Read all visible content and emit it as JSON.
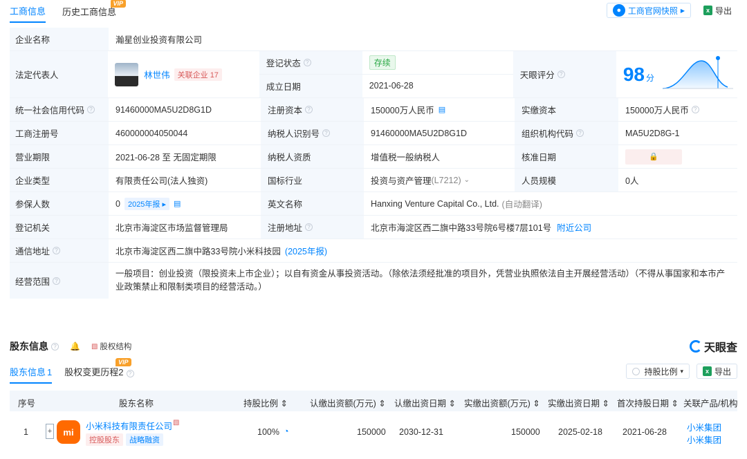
{
  "top_tabs": {
    "business": "工商信息",
    "history": "历史工商信息",
    "vip": "VIP"
  },
  "top_actions": {
    "snapshot": "工商官网快照",
    "export": "导出"
  },
  "info": {
    "company_name_label": "企业名称",
    "company_name": "瀚星创业投资有限公司",
    "legal_rep_label": "法定代表人",
    "legal_rep": "林世伟",
    "related_label": "关联企业",
    "related_count": "17",
    "reg_status_label": "登记状态",
    "reg_status": "存续",
    "est_date_label": "成立日期",
    "est_date": "2021-06-28",
    "tianyan_label": "天眼评分",
    "score": "98",
    "score_unit": "分",
    "credit_code_label": "统一社会信用代码",
    "credit_code": "91460000MA5U2D8G1D",
    "reg_capital_label": "注册资本",
    "reg_capital": "150000万人民币",
    "paid_capital_label": "实缴资本",
    "paid_capital": "150000万人民币",
    "reg_no_label": "工商注册号",
    "reg_no": "460000004050044",
    "taxpayer_id_label": "纳税人识别号",
    "taxpayer_id": "91460000MA5U2D8G1D",
    "org_code_label": "组织机构代码",
    "org_code": "MA5U2D8G-1",
    "term_label": "营业期限",
    "term": "2021-06-28 至 无固定期限",
    "taxpayer_qual_label": "纳税人资质",
    "taxpayer_qual": "增值税一般纳税人",
    "approval_label": "核准日期",
    "type_label": "企业类型",
    "type": "有限责任公司(法人独资)",
    "industry_label": "国标行业",
    "industry": "投资与资产管理",
    "industry_code": "(L7212)",
    "staff_label": "人员规模",
    "staff": "0人",
    "insured_label": "参保人数",
    "insured": "0",
    "insured_report": "2025年报",
    "english_label": "英文名称",
    "english": "Hanxing Venture Capital Co., Ltd.",
    "auto_translate": "(自动翻译)",
    "authority_label": "登记机关",
    "authority": "北京市海淀区市场监督管理局",
    "address_label": "注册地址",
    "address": "北京市海淀区西二旗中路33号院6号楼7层101号",
    "nearby": "附近公司",
    "mail_label": "通信地址",
    "mail": "北京市海淀区西二旗中路33号院小米科技园",
    "mail_report": "(2025年报)",
    "scope_label": "经营范围",
    "scope": "一般项目：创业投资（限投资未上市企业）；以自有资金从事投资活动。（除依法须经批准的项目外，凭营业执照依法自主开展经营活动）（不得从事国家和本市产业政策禁止和限制类项目的经营活动。）"
  },
  "shareholders": {
    "title": "股东信息",
    "structure": "股权结构",
    "brand": "天眼查",
    "tab_info": "股东信息",
    "tab_info_count": "1",
    "tab_change": "股权变更历程",
    "tab_change_count": "2",
    "vip": "VIP",
    "ratio_btn": "持股比例",
    "export": "导出",
    "columns": [
      "序号",
      "股东名称",
      "持股比例",
      "认缴出资额(万元)",
      "认缴出资日期",
      "实缴出资额(万元)",
      "实缴出资日期",
      "首次持股日期",
      "关联产品/机构"
    ],
    "row": {
      "index": "1",
      "name": "小米科技有限责任公司",
      "logo": "mi",
      "tag1": "控股股东",
      "tag2": "战略融资",
      "ratio": "100%",
      "subscribed": "150000",
      "sub_date": "2030-12-31",
      "paid": "150000",
      "paid_date": "2025-02-18",
      "first_date": "2021-06-28",
      "product1": "小米集团",
      "product2": "小米集团"
    }
  },
  "colors": {
    "accent": "#0084ff",
    "label_bg": "#f4f8fd"
  }
}
